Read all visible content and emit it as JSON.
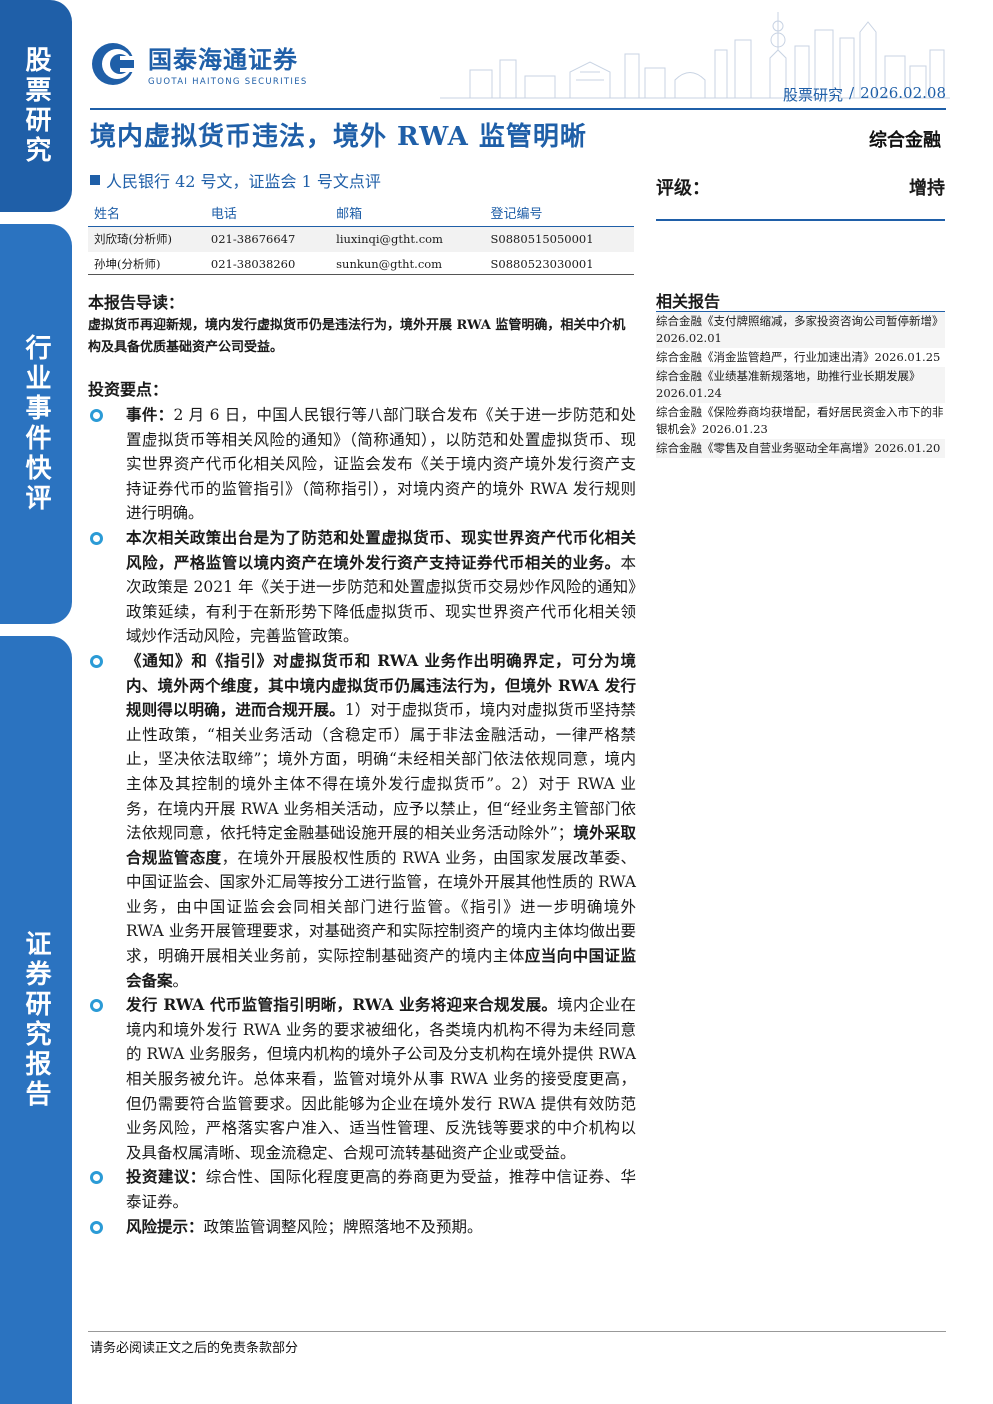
{
  "sidebar": {
    "tab1": "股票研究",
    "tab2": "行业事件快评",
    "tab3": "证券研究报告"
  },
  "header": {
    "logo_cn": "国泰海通证券",
    "logo_en": "GUOTAI HAITONG SECURITIES",
    "category": "股票研究",
    "separator": "/",
    "date": "2026.02.08"
  },
  "report": {
    "title": "境内虚拟货币违法，境外 RWA 监管明晰",
    "subtitle": "人民银行 42 号文，证监会 1 号文点评",
    "sector": "综合金融",
    "rating_label": "评级：",
    "rating_value": "增持"
  },
  "analysts": {
    "headers": [
      "姓名",
      "电话",
      "邮箱",
      "登记编号"
    ],
    "rows": [
      [
        "刘欣琦(分析师)",
        "021-38676647",
        "liuxinqi@gtht.com",
        "S0880515050001"
      ],
      [
        "孙坤(分析师)",
        "021-38038260",
        "sunkun@gtht.com",
        "S0880523030001"
      ]
    ]
  },
  "guide": {
    "heading": "本报告导读：",
    "text": "虚拟货币再迎新规，境内发行虚拟货币仍是违法行为，境外开展 RWA 监管明确，相关中介机构及具备优质基础资产公司受益。"
  },
  "points": {
    "heading": "投资要点：",
    "items": [
      {
        "bold": "事件：",
        "text": "2 月 6 日，中国人民银行等八部门联合发布《关于进一步防范和处置虚拟货币等相关风险的通知》（简称通知），以防范和处置虚拟货币、现实世界资产代币化相关风险，证监会发布《关于境内资产境外发行资产支持证券代币的监管指引》（简称指引），对境内资产的境外 RWA 发行规则进行明确。",
        "bold2": "",
        "text2": ""
      },
      {
        "bold": "本次相关政策出台是为了防范和处置虚拟货币、现实世界资产代币化相关风险，严格监管以境内资产在境外发行资产支持证券代币相关的业务。",
        "text": "本次政策是 2021 年《关于进一步防范和处置虚拟货币交易炒作风险的通知》政策延续，有利于在新形势下降低虚拟货币、现实世界资产代币化相关领域炒作活动风险，完善监管政策。",
        "bold2": "",
        "text2": ""
      },
      {
        "bold": "《通知》和《指引》对虚拟货币和 RWA 业务作出明确界定，可分为境内、境外两个维度，其中境内虚拟货币仍属违法行为，但境外 RWA 发行规则得以明确，进而合规开展。",
        "text": "1）对于虚拟货币，境内对虚拟货币坚持禁止性政策，“相关业务活动（含稳定币）属于非法金融活动，一律严格禁止，坚决依法取缔”；境外方面，明确“未经相关部门依法依规同意，境内主体及其控制的境外主体不得在境外发行虚拟货币”。2）对于 RWA 业务，在境内开展 RWA 业务相关活动，应予以禁止，但“经业务主管部门依法依规同意，依托特定金融基础设施开展的相关业务活动除外”；",
        "bold2": "境外采取合规监管态度",
        "text2": "，在境外开展股权性质的 RWA 业务，由国家发展改革委、中国证监会、国家外汇局等按分工进行监管，在境外开展其他性质的 RWA 业务，由中国证监会会同相关部门进行监管。《指引》进一步明确境外 RWA 业务开展管理要求，对基础资产和实际控制资产的境内主体均做出要求，明确开展相关业务前，实际控制基础资产的境内主体",
        "bold3": "应当向中国证监会备案",
        "text3": "。"
      },
      {
        "bold": "发行 RWA 代币监管指引明晰，RWA 业务将迎来合规发展。",
        "text": "境内企业在境内和境外发行 RWA 业务的要求被细化，各类境内机构不得为未经同意的 RWA 业务服务，但境内机构的境外子公司及分支机构在境外提供 RWA 相关服务被允许。总体来看，监管对境外从事 RWA 业务的接受度更高，但仍需要符合监管要求。因此能够为企业在境外发行 RWA 提供有效防范业务风险，严格落实客户准入、适当性管理、反洗钱等要求的中介机构以及具备权属清晰、现金流稳定、合规可流转基础资产企业或受益。",
        "bold2": "",
        "text2": ""
      },
      {
        "bold": "投资建议：",
        "text": "综合性、国际化程度更高的券商更为受益，推荐中信证券、华泰证券。",
        "bold2": "",
        "text2": ""
      },
      {
        "bold": "风险提示：",
        "text": "政策监管调整风险；牌照落地不及预期。",
        "bold2": "",
        "text2": ""
      }
    ]
  },
  "related": {
    "heading": "相关报告",
    "items": [
      "综合金融《支付牌照缩减，多家投资咨询公司暂停新增》2026.02.01",
      "综合金融《消金监管趋严，行业加速出清》2026.01.25",
      "综合金融《业绩基准新规落地，助推行业长期发展》2026.01.24",
      "综合金融《保险券商均获增配，看好居民资金入市下的非银机会》2026.01.23",
      "综合金融《零售及自营业务驱动全年高增》2026.01.20"
    ]
  },
  "footer": {
    "disclaimer": "请务必阅读正文之后的免责条款部分"
  },
  "colors": {
    "brand": "#1f5fa8",
    "tab": "#2b73c0",
    "bullet": "#2b9bd6"
  }
}
